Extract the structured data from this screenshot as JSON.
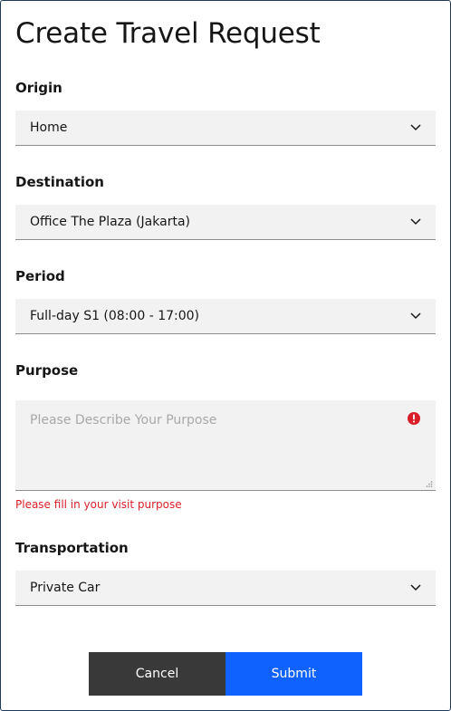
{
  "title": "Create Travel Request",
  "fields": {
    "origin": {
      "label": "Origin",
      "value": "Home",
      "icon": "chevron-down-icon"
    },
    "destination": {
      "label": "Destination",
      "value": "Office The Plaza (Jakarta)",
      "icon": "chevron-down-icon"
    },
    "period": {
      "label": "Period",
      "value": "Full-day S1 (08:00 - 17:00)",
      "icon": "chevron-down-icon"
    },
    "purpose": {
      "label": "Purpose",
      "value": "",
      "placeholder": "Please Describe Your Purpose",
      "error": "Please fill in your visit purpose",
      "icon": "error-icon"
    },
    "transportation": {
      "label": "Transportation",
      "value": "Private Car",
      "icon": "chevron-down-icon"
    }
  },
  "buttons": {
    "cancel": "Cancel",
    "submit": "Submit"
  },
  "colors": {
    "field_bg": "#f2f2f2",
    "error": "#da1e28",
    "cancel_bg": "#393939",
    "submit_bg": "#0f62fe",
    "border": "#1f3b5c"
  }
}
